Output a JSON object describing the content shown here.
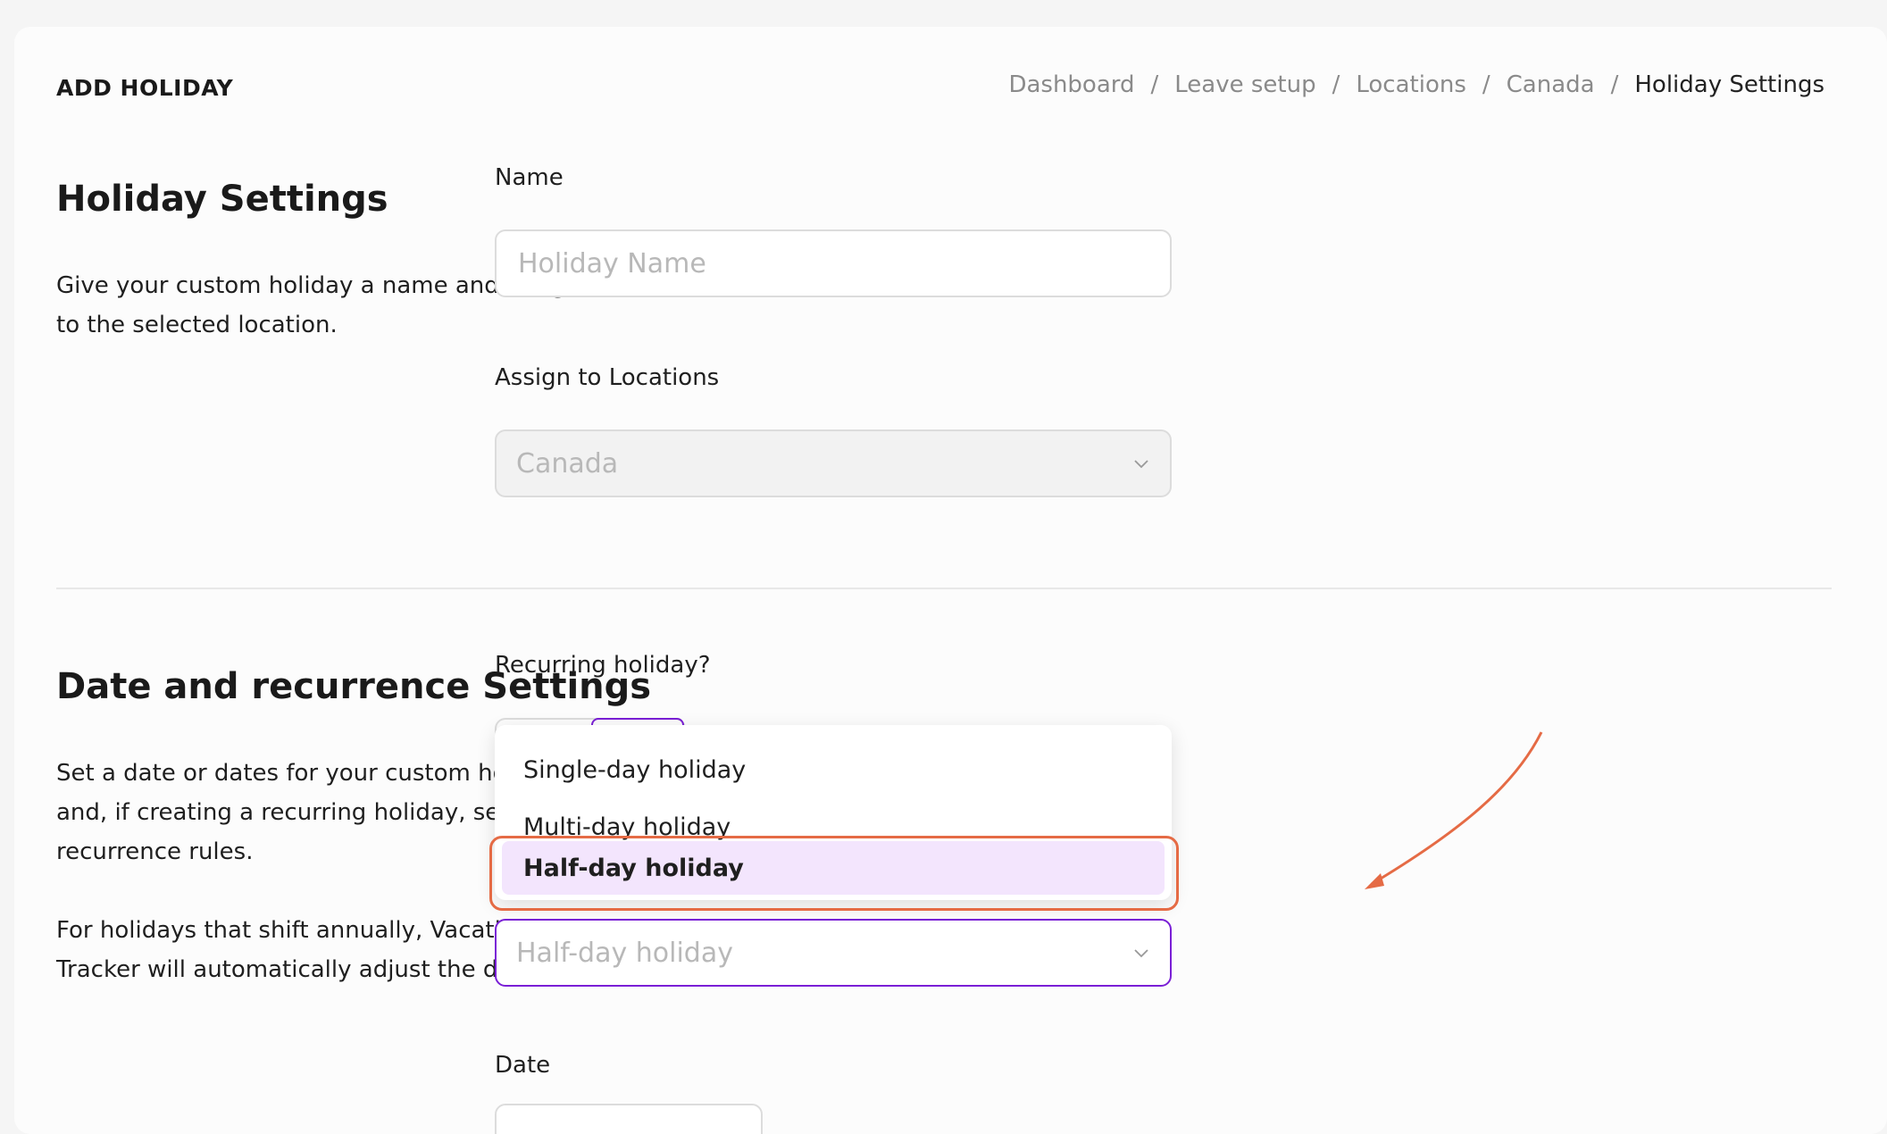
{
  "header": {
    "title": "ADD HOLIDAY",
    "breadcrumb": [
      "Dashboard",
      "Leave setup",
      "Locations",
      "Canada",
      "Holiday Settings"
    ],
    "separator": "/"
  },
  "holiday_settings": {
    "title": "Holiday Settings",
    "description_line1": "Give your custom holiday a name and assign it",
    "description_line2": "to the selected location.",
    "name_label": "Name",
    "name_placeholder": "Holiday Name",
    "locations_label": "Assign to Locations",
    "locations_value": "Canada"
  },
  "date_settings": {
    "title": "Date and recurrence Settings",
    "description1_line1": "Set a date or dates for your custom holiday",
    "description1_line2": "and, if creating a recurring holiday, set the",
    "description1_line3": "recurrence rules.",
    "description2_line1": "For holidays that shift annually, Vacation",
    "description2_line2": "Tracker will automatically adjust the date.",
    "recurring_label": "Recurring holiday?",
    "type_options": [
      "Single-day holiday",
      "Multi-day holiday",
      "Half-day holiday"
    ],
    "type_selected": "Half-day holiday",
    "type_value": "Half-day holiday",
    "date_label": "Date"
  },
  "colors": {
    "accent": "#7a1fd6",
    "selected_bg": "#f3e5fd",
    "annotation": "#e56b45"
  }
}
